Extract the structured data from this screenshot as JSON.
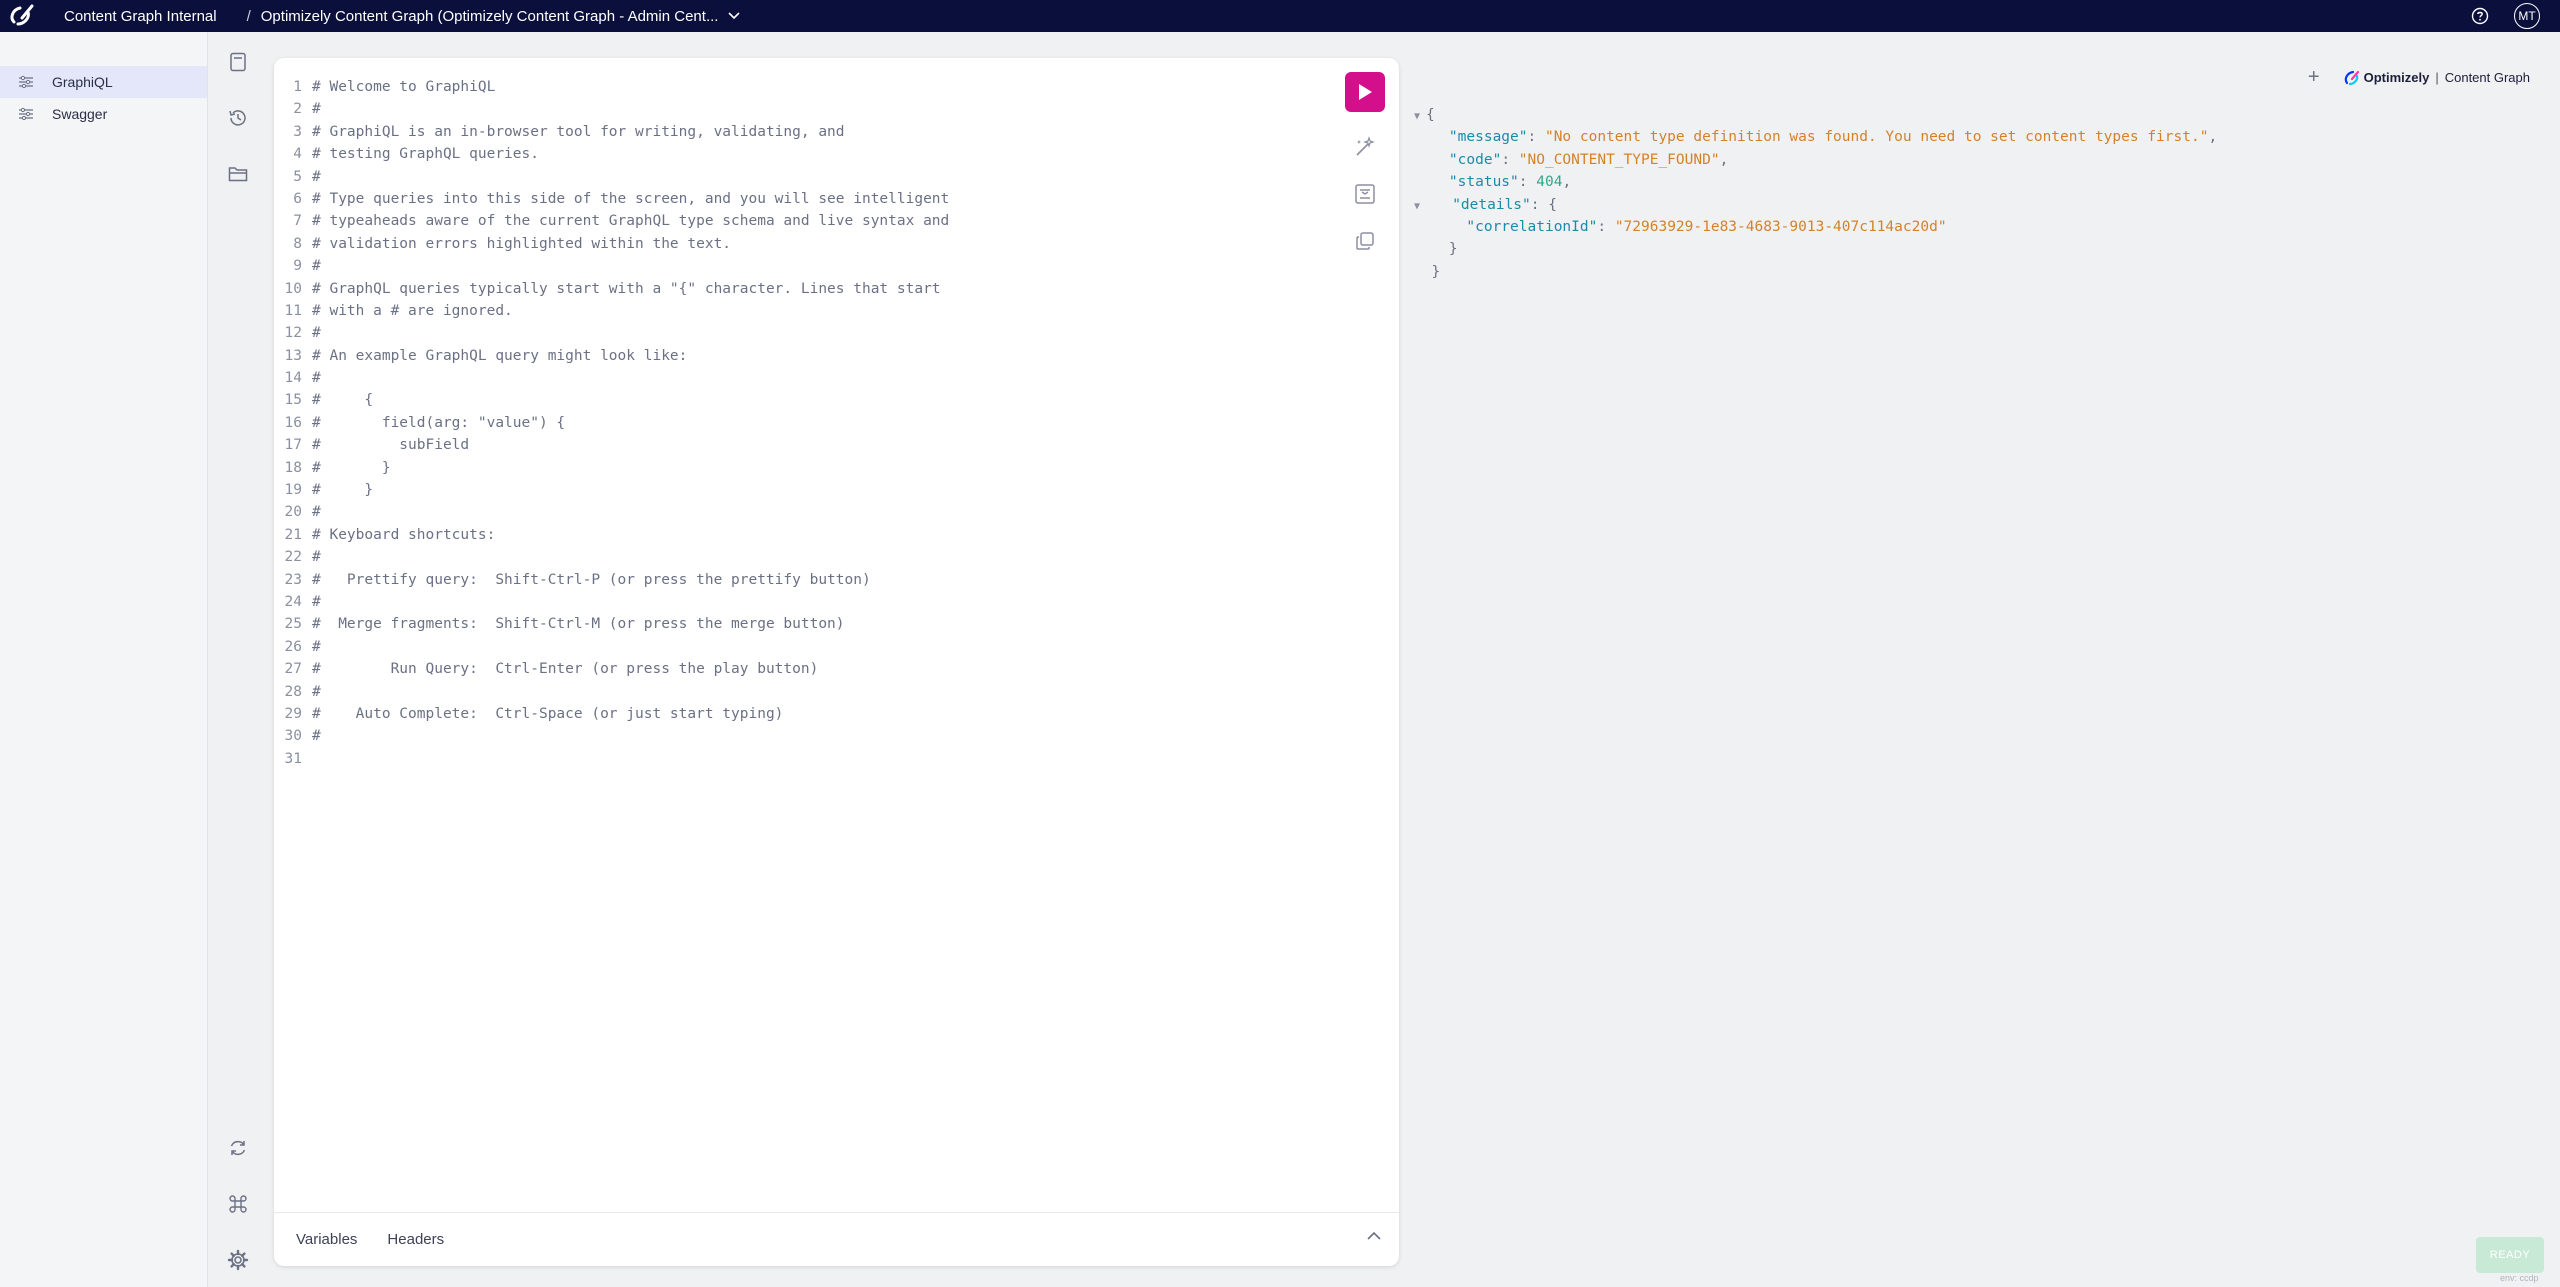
{
  "header": {
    "app_name": "Content Graph Internal",
    "separator": "/",
    "instance_label": "Optimizely Content Graph (Optimizely Content Graph - Admin Cent...",
    "avatar_initials": "MT",
    "bg_color": "#0b0f3c"
  },
  "sidebar": {
    "items": [
      {
        "label": "GraphiQL",
        "icon": "sliders-icon",
        "active": true
      },
      {
        "label": "Swagger",
        "icon": "sliders-icon",
        "active": false
      }
    ]
  },
  "rail": {
    "icons": [
      "doc-icon",
      "history-icon",
      "folder-icon",
      "refresh-icon",
      "command-icon",
      "settings-icon"
    ]
  },
  "editor": {
    "lines": [
      "# Welcome to GraphiQL",
      "#",
      "# GraphiQL is an in-browser tool for writing, validating, and",
      "# testing GraphQL queries.",
      "#",
      "# Type queries into this side of the screen, and you will see intelligent",
      "# typeaheads aware of the current GraphQL type schema and live syntax and",
      "# validation errors highlighted within the text.",
      "#",
      "# GraphQL queries typically start with a \"{\" character. Lines that start",
      "# with a # are ignored.",
      "#",
      "# An example GraphQL query might look like:",
      "#",
      "#     {",
      "#       field(arg: \"value\") {",
      "#         subField",
      "#       }",
      "#     }",
      "#",
      "# Keyboard shortcuts:",
      "#",
      "#   Prettify query:  Shift-Ctrl-P (or press the prettify button)",
      "#",
      "#  Merge fragments:  Shift-Ctrl-M (or press the merge button)",
      "#",
      "#        Run Query:  Ctrl-Enter (or press the play button)",
      "#",
      "#    Auto Complete:  Ctrl-Space (or just start typing)",
      "#",
      ""
    ],
    "footer": {
      "variables": "Variables",
      "headers": "Headers"
    },
    "run_color": "#d40f8c"
  },
  "result": {
    "plus": "+",
    "brand_name": "Optimizely",
    "brand_divider": "|",
    "brand_product": "Content Graph",
    "json": {
      "open": "{",
      "message_key": "\"message\"",
      "message_val": "\"No content type definition was found. You need to set content types first.\"",
      "code_key": "\"code\"",
      "code_val": "\"NO_CONTENT_TYPE_FOUND\"",
      "status_key": "\"status\"",
      "status_val": "404",
      "details_key": "\"details\"",
      "details_open": "{",
      "correlation_key": "\"correlationId\"",
      "correlation_val": "\"72963929-1e83-4683-9013-407c114ac20d\"",
      "details_close": "}",
      "close": "}",
      "colon": ": ",
      "comma": ","
    }
  },
  "status": {
    "ready": "READY",
    "env": "env: ccdp"
  }
}
